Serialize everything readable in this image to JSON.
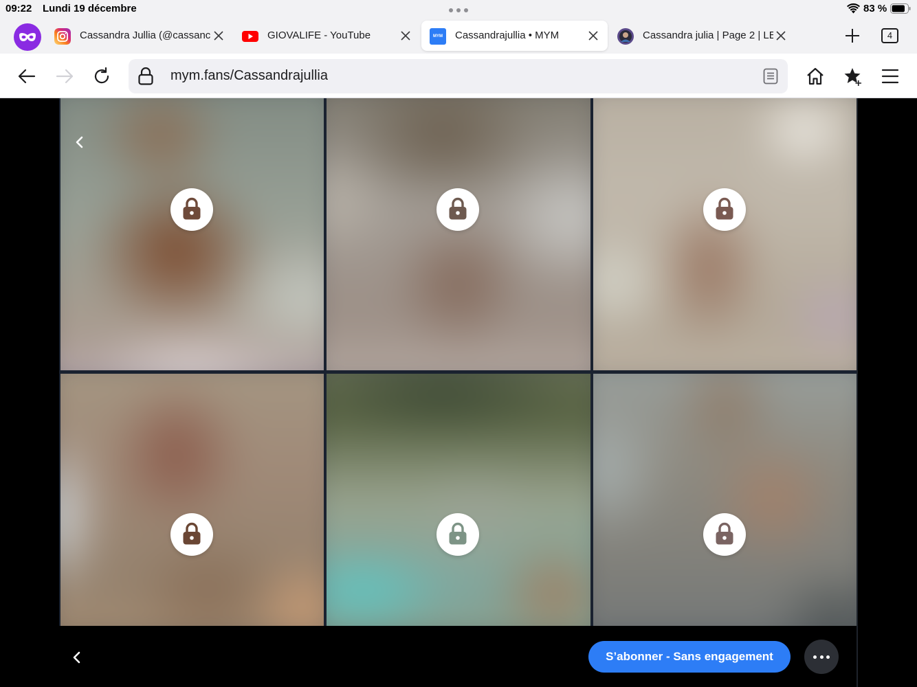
{
  "status_bar": {
    "time": "09:22",
    "date": "Lundi 19 décembre",
    "battery": "83 %"
  },
  "tabs": [
    {
      "title": "Cassandra Jullia (@cassanc",
      "favicon": "instagram-icon",
      "active": false
    },
    {
      "title": "GIOVALIFE - YouTube",
      "favicon": "youtube-icon",
      "active": false
    },
    {
      "title": "Cassandrajullia • MYM",
      "favicon": "mym-icon",
      "favicon_label": "MYM",
      "active": true
    },
    {
      "title": "Cassandra julia | Page 2 | LE",
      "favicon": "avatar-icon",
      "active": false
    }
  ],
  "tab_count": "4",
  "url_bar": {
    "url": "mym.fans/Cassandrajullia"
  },
  "subscribe_button": {
    "label": "S’abonner - Sans engagement"
  },
  "colors": {
    "private_purple": "#8a2be2",
    "accent_blue": "#2d7df6",
    "instagram": "#e1306c",
    "youtube": "#ff0000",
    "mym": "#2d7df6"
  },
  "gallery": [
    {
      "lock_color": "#6e4a3a"
    },
    {
      "lock_color": "#6e5a50"
    },
    {
      "lock_color": "#7a5a52"
    },
    {
      "lock_color": "#6a4634"
    },
    {
      "lock_color": "#7d9486"
    },
    {
      "lock_color": "#7a6462"
    }
  ]
}
